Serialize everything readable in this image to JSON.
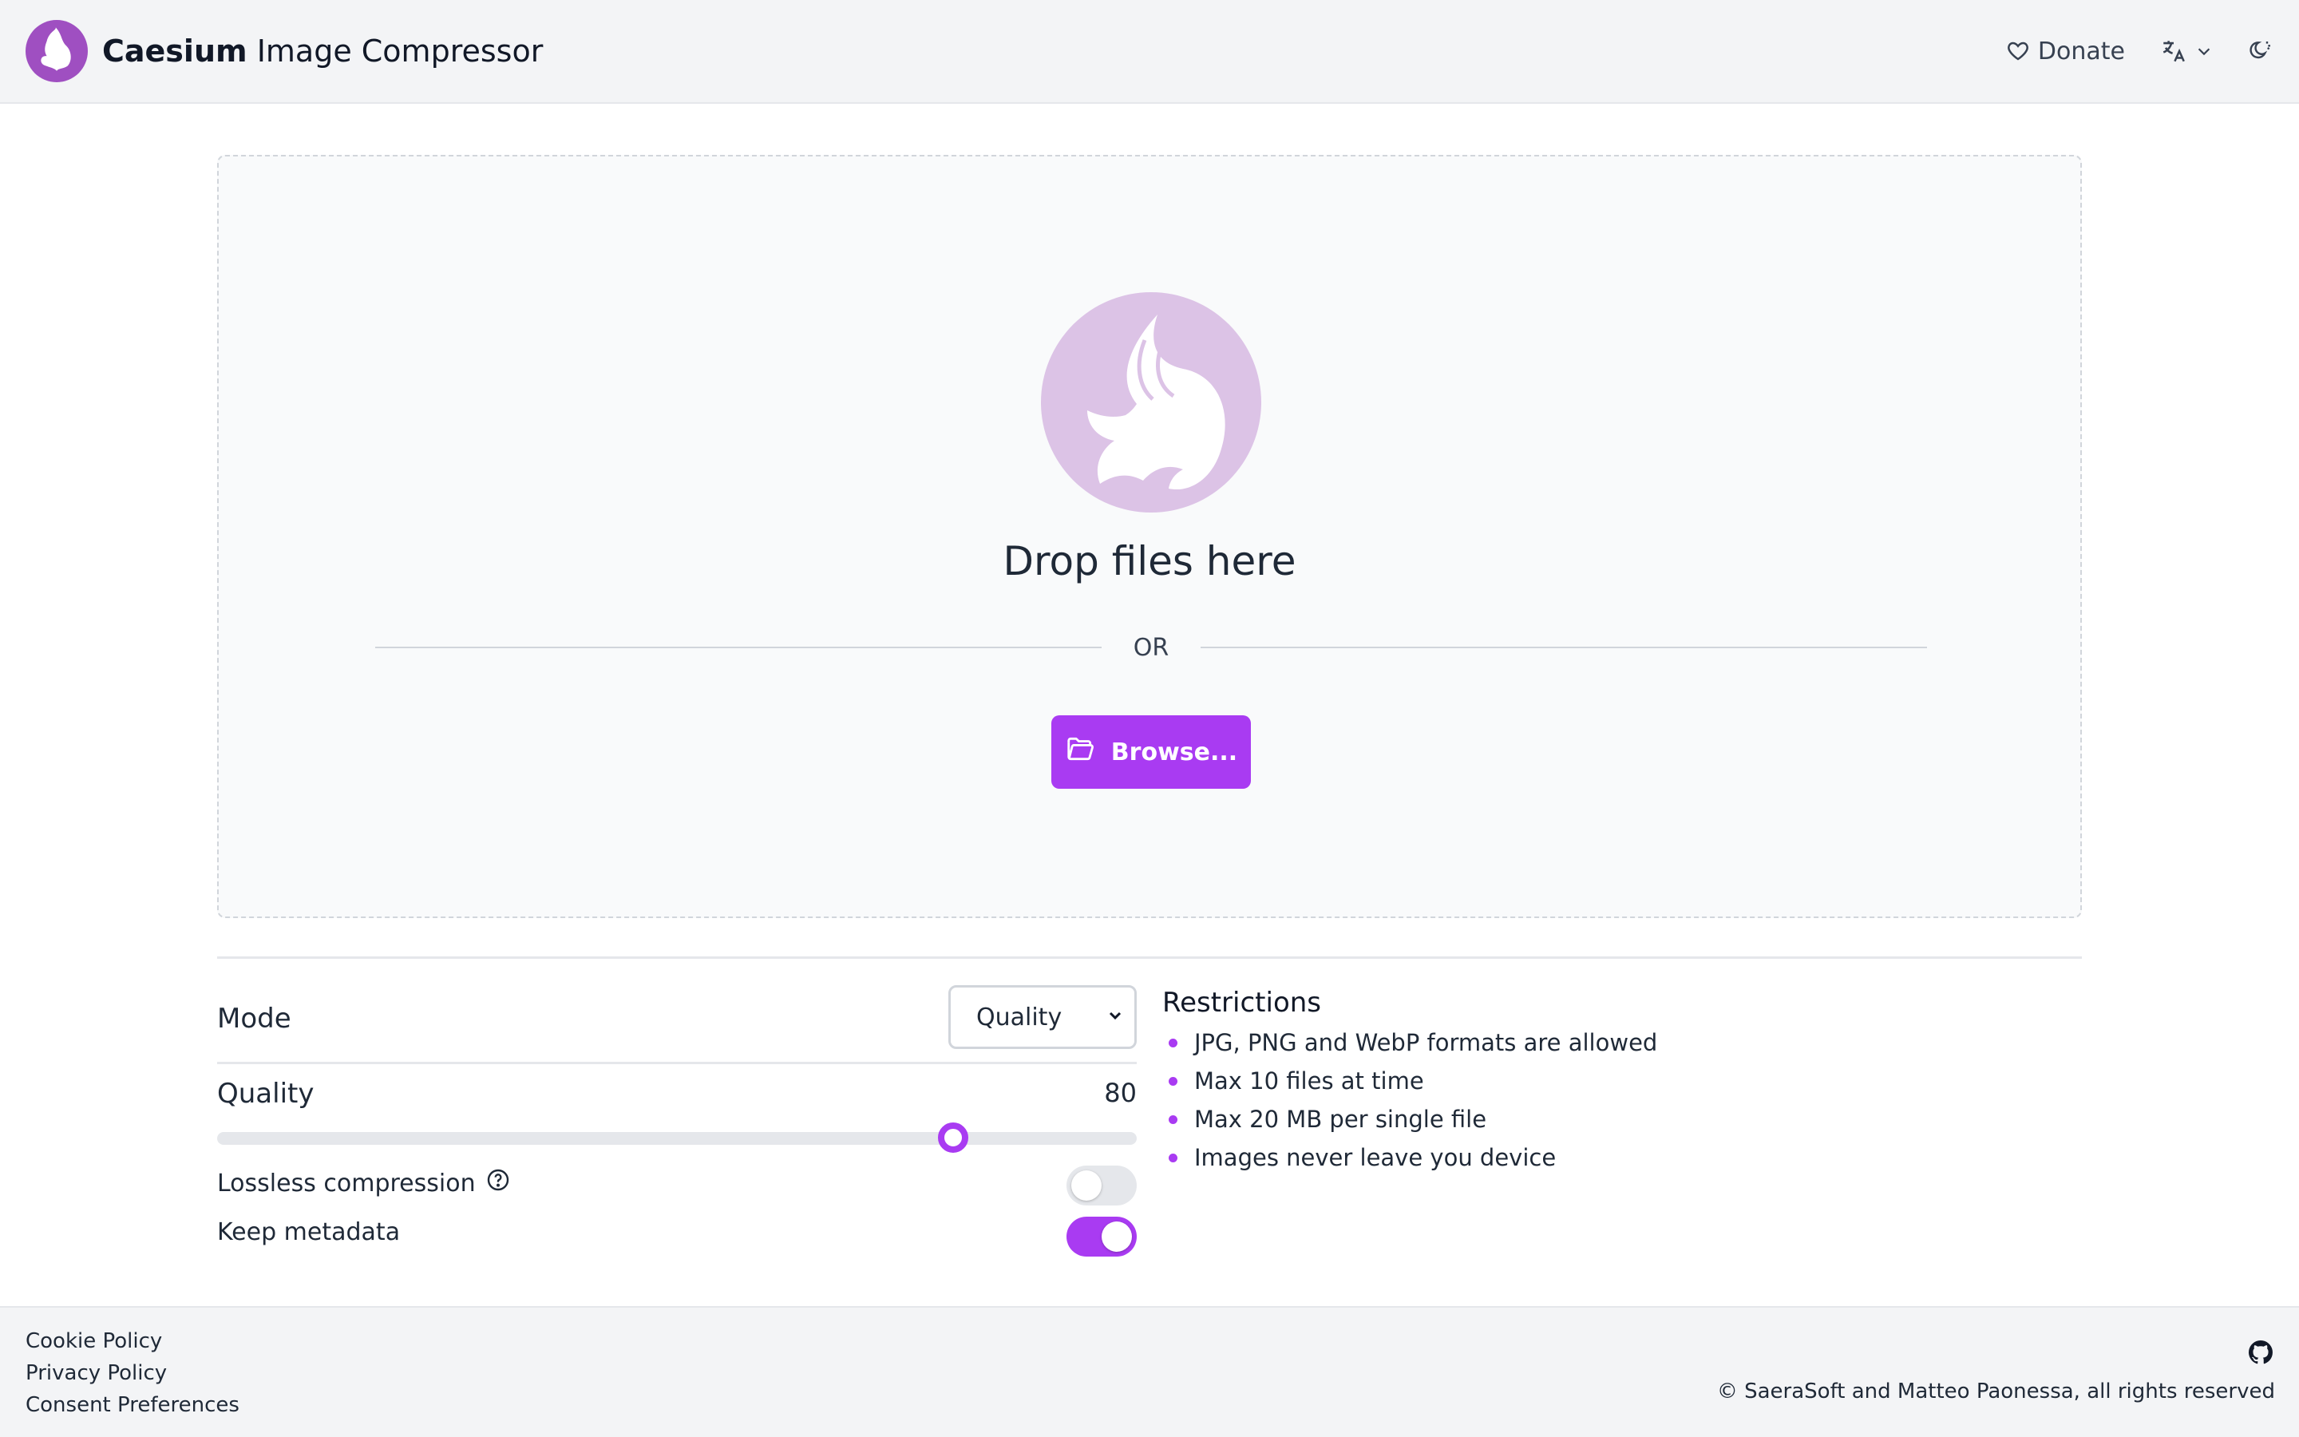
{
  "header": {
    "brand_bold": "Caesium",
    "brand_rest": " Image Compressor",
    "donate_label": "Donate"
  },
  "dropzone": {
    "title": "Drop files here",
    "or_text": "OR",
    "browse_label": "Browse..."
  },
  "settings": {
    "mode_label": "Mode",
    "mode_value": "Quality",
    "quality_label": "Quality",
    "quality_value": "80",
    "quality_level": 80,
    "lossless_label": "Lossless compression",
    "lossless_on": false,
    "metadata_label": "Keep metadata",
    "metadata_on": true
  },
  "restrictions": {
    "title": "Restrictions",
    "items": [
      "JPG, PNG and WebP formats are allowed",
      "Max 10 files at time",
      "Max 20 MB per single file",
      "Images never leave you device"
    ]
  },
  "footer": {
    "links": [
      "Cookie Policy",
      "Privacy Policy",
      "Consent Preferences"
    ],
    "copyright": "© SaeraSoft and Matteo Paonessa, all rights reserved"
  },
  "colors": {
    "accent": "#a93bf2",
    "logo": "#9f4fc1",
    "hero": "#dcc3e6"
  },
  "icons": {
    "logo": "phoenix-logo-icon",
    "donate": "heart-icon",
    "language": "translate-icon",
    "theme": "theme-toggle-icon",
    "browse": "folder-open-icon",
    "help": "question-circle-icon",
    "github": "github-icon"
  }
}
